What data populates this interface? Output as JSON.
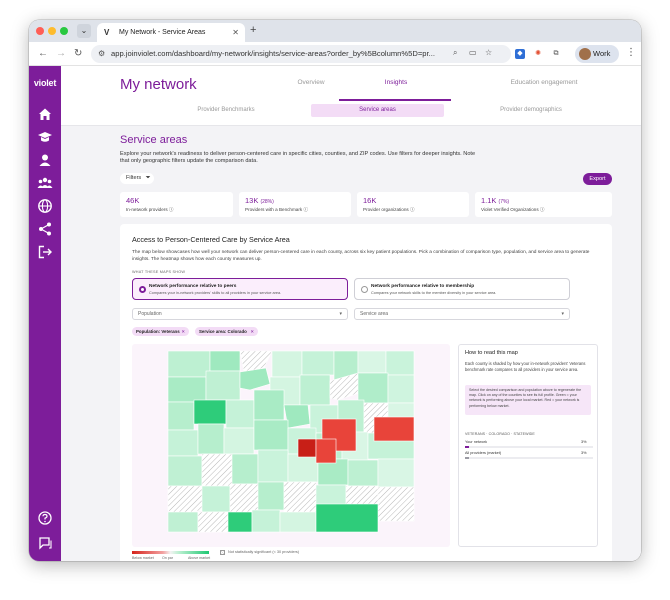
{
  "browser": {
    "tab_title": "My Network - Service Areas",
    "url": "app.joinviolet.com/dashboard/my-network/insights/service-areas?order_by%5Bcolumn%5D=pr...",
    "profile_label": "Work"
  },
  "app": {
    "logo": "violet",
    "page_title": "My network",
    "tabs": [
      {
        "label": "Overview"
      },
      {
        "label": "Insights"
      },
      {
        "label": "Education engagement"
      }
    ],
    "subtabs": [
      {
        "label": "Provider Benchmarks"
      },
      {
        "label": "Service areas"
      },
      {
        "label": "Provider demographics"
      }
    ]
  },
  "section": {
    "title": "Service areas",
    "description": "Explore your network's readiness to deliver person-centered care in specific cities, counties, and ZIP codes. Use filters for deeper insights. Note that only geographic filters update the comparison data.",
    "filters_label": "Filters",
    "export_label": "Export"
  },
  "stats": [
    {
      "value": "46K",
      "pct": "",
      "label": "In-network providers"
    },
    {
      "value": "13K",
      "pct": "(28%)",
      "label": "Providers with a Benchmark"
    },
    {
      "value": "16K",
      "pct": "",
      "label": "Provider organizations"
    },
    {
      "value": "1.1K",
      "pct": "(7%)",
      "label": "Violet Verified Organizations"
    }
  ],
  "card": {
    "title": "Access to Person-Centered Care by Service Area",
    "description": "The map below showcases how well your network can deliver person-centered care in each county, across six key patient populations. Pick a combination of comparison type, population, and service area to generate insights. The heatmap shows how each county measures up.",
    "maps_show_label": "WHAT THESE MAPS SHOW",
    "radio_options": [
      {
        "title": "Network performance relative to peers",
        "subtitle": "Compares your in-network providers' skills to all providers in your service area."
      },
      {
        "title": "Network performance relative to membership",
        "subtitle": "Compares your network skills to the member diversity in your service area."
      }
    ],
    "population_placeholder": "Population",
    "service_area_placeholder": "Service area",
    "chips": [
      {
        "label": "Population: Veterans"
      },
      {
        "label": "Service area: Colorado"
      }
    ],
    "legend": {
      "below": "Below market",
      "on_par": "On par",
      "above": "Above market",
      "not_significant": "Not statistically significant (< 30 providers)"
    }
  },
  "howto": {
    "title": "How to read this map",
    "text": "Each county is shaded by how your in-network providers' Veterans benchmark rate compares to all providers in your service area.",
    "note": "Select the desired comparison and population above to regenerate the map. Click on any of the counties to see its full profile. Green = your network is performing above your local market. Red = your network is performing below market.",
    "caption": "VETERANS · COLORADO · STATEWIDE",
    "bars": [
      {
        "label": "Your network",
        "value": "3%",
        "fraction": 0.03
      },
      {
        "label": "All providers (market)",
        "value": "3%",
        "fraction": 0.03
      }
    ]
  },
  "colors": {
    "brand": "#7d1d9a",
    "below_market": "#e8443a",
    "above_market": "#2ecc7a"
  }
}
